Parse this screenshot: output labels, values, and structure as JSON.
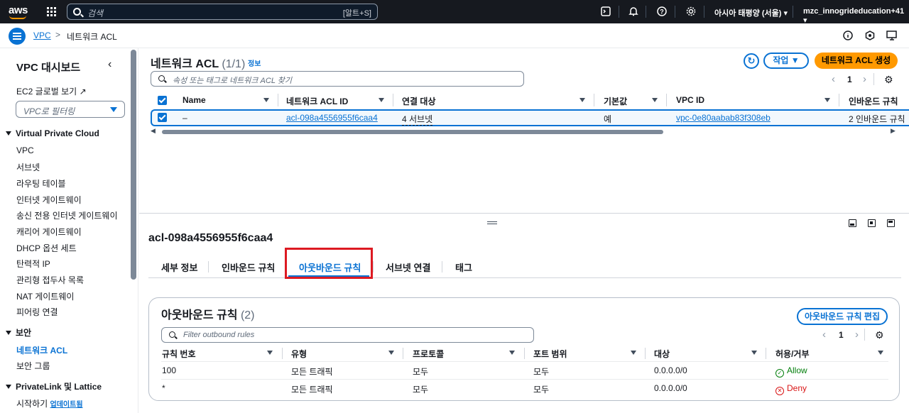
{
  "topbar": {
    "logo": "aws",
    "search_placeholder": "검색",
    "search_shortcut": "[알트+S]",
    "region": "아시아 태평양 (서울) ▾",
    "account": "mzc_innogrideducation+41 ▾",
    "icons": [
      "services-grid-icon",
      "cloudshell-icon",
      "bell-icon",
      "help-icon",
      "gear-icon"
    ]
  },
  "breadcrumb": {
    "root": "VPC",
    "separator": ">",
    "current": "네트워크 ACL"
  },
  "sidebar": {
    "title": "VPC 대시보드",
    "ec2_link": "EC2 글로벌 보기",
    "filter_placeholder": "VPC로 필터링",
    "sections": [
      {
        "title": "Virtual Private Cloud",
        "items": [
          "VPC",
          "서브넷",
          "라우팅 테이블",
          "인터넷 게이트웨이",
          "송신 전용 인터넷 게이트웨이",
          "캐리어 게이트웨이",
          "DHCP 옵션 세트",
          "탄력적 IP",
          "관리형 접두사 목록",
          "NAT 게이트웨이",
          "피어링 연결"
        ]
      },
      {
        "title": "보안",
        "items": [
          "네트워크 ACL",
          "보안 그룹"
        ]
      },
      {
        "title": "PrivateLink 및 Lattice",
        "items": [
          "시작하기"
        ]
      }
    ],
    "update_badge": "업데이트됨",
    "active_item": "네트워크 ACL"
  },
  "list": {
    "title": "네트워크 ACL",
    "count": "(1/1)",
    "info": "정보",
    "actions_label": "작업 ▼",
    "create_label": "네트워크 ACL 생성",
    "search_placeholder": "속성 또는 태그로 네트워크 ACL 찾기",
    "page": "1",
    "columns": [
      "Name",
      "네트워크 ACL ID",
      "연결 대상",
      "기본값",
      "VPC ID",
      "인바운드 규칙"
    ],
    "row": {
      "name": "–",
      "acl_id": "acl-098a4556955f6caa4",
      "associated": "4 서브넷",
      "default": "예",
      "vpc_id": "vpc-0e80aabab83f308eb",
      "inbound": "2 인바운드 규칙"
    }
  },
  "detail": {
    "title": "acl-098a4556955f6caa4",
    "tabs": [
      "세부 정보",
      "인바운드 규칙",
      "아웃바운드 규칙",
      "서브넷 연결",
      "태그"
    ],
    "active_tab": "아웃바운드 규칙",
    "card": {
      "title": "아웃바운드 규칙",
      "count": "(2)",
      "edit_label": "아웃바운드 규칙 편집",
      "filter_placeholder": "Filter outbound rules",
      "page": "1",
      "columns": [
        "규칙 번호",
        "유형",
        "프로토콜",
        "포트 범위",
        "대상",
        "허용/거부"
      ],
      "rows": [
        {
          "rule": "100",
          "type": "모든 트래픽",
          "protocol": "모두",
          "port": "모두",
          "dest": "0.0.0.0/0",
          "action": "Allow"
        },
        {
          "rule": "*",
          "type": "모든 트래픽",
          "protocol": "모두",
          "port": "모두",
          "dest": "0.0.0.0/0",
          "action": "Deny"
        }
      ]
    }
  },
  "colors": {
    "accent": "#0972d3",
    "primary_button": "#ff9900",
    "allow": "#037f0c",
    "deny": "#d91515",
    "highlight": "#dd1a22"
  }
}
